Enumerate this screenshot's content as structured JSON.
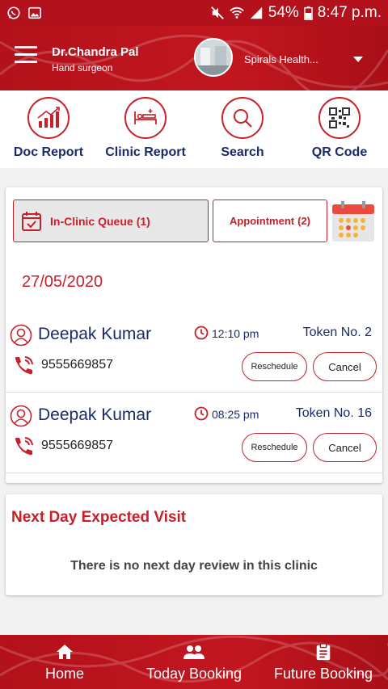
{
  "statusbar": {
    "battery": "54%",
    "time": "8:47 p.m."
  },
  "header": {
    "doctor_name": "Dr.Chandra Pal",
    "doctor_role": "Hand surgeon",
    "clinic_name": "Spirals Health..."
  },
  "actions": [
    {
      "label": "Doc Report",
      "icon": "chart-growth-icon"
    },
    {
      "label": "Clinic Report",
      "icon": "hospital-bed-icon"
    },
    {
      "label": "Search",
      "icon": "search-icon"
    },
    {
      "label": "QR Code",
      "icon": "qr-code-icon"
    }
  ],
  "queue": {
    "tabs": [
      {
        "label": "In-Clinic  Queue",
        "count": "(1)"
      },
      {
        "label": "Appointment",
        "count": "(2)"
      }
    ],
    "date": "27/05/2020",
    "reschedule_label": "Reschedule",
    "cancel_label": "Cancel",
    "patients": [
      {
        "name": "Deepak Kumar",
        "time": "12:10 pm",
        "token": "Token No. 2",
        "phone": "9555669857"
      },
      {
        "name": "Deepak Kumar",
        "time": "08:25 pm",
        "token": "Token No. 16",
        "phone": "9555669857"
      }
    ]
  },
  "next_day": {
    "title": "Next Day Expected Visit",
    "message": "There is no next day review in this clinic"
  },
  "bottom_nav": [
    {
      "label": "Home",
      "icon": "home-icon"
    },
    {
      "label": "Today Booking",
      "icon": "people-icon"
    },
    {
      "label": "Future Booking",
      "icon": "clipboard-icon"
    }
  ],
  "colors": {
    "brand_red": "#c8202a",
    "header_red": "#b3111b",
    "navy_text": "#1a2a6c"
  }
}
